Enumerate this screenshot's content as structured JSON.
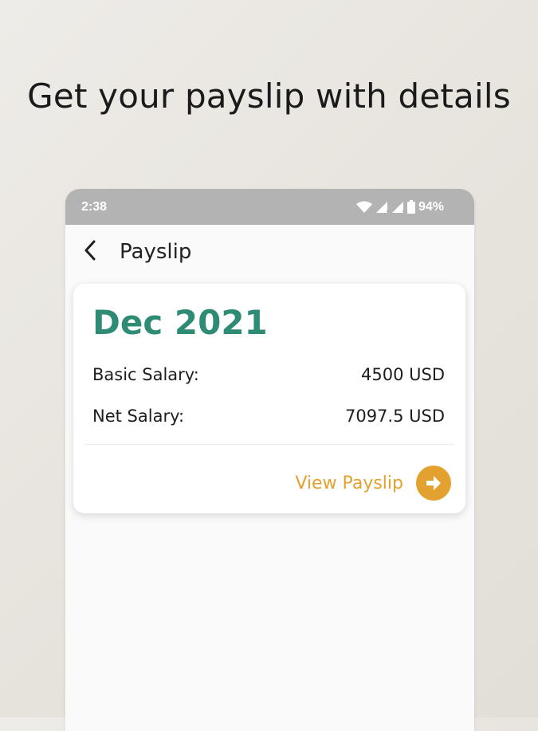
{
  "promo": {
    "headline": "Get your payslip with details"
  },
  "status_bar": {
    "time": "2:38",
    "battery": "94%",
    "icons": [
      "wifi-icon",
      "signal-icon",
      "signal-icon",
      "battery-icon"
    ]
  },
  "app_bar": {
    "title": "Payslip",
    "back_icon": "back-arrow-icon"
  },
  "payslip": {
    "month": "Dec 2021",
    "basic_label": "Basic Salary:",
    "basic_value": "4500 USD",
    "net_label": "Net Salary:",
    "net_value": "7097.5 USD",
    "view_label": "View Payslip",
    "view_icon": "arrow-right-icon"
  },
  "colors": {
    "accent_green": "#2e8b74",
    "accent_orange": "#e3a12f",
    "status_bar": "#b3b3b3"
  }
}
